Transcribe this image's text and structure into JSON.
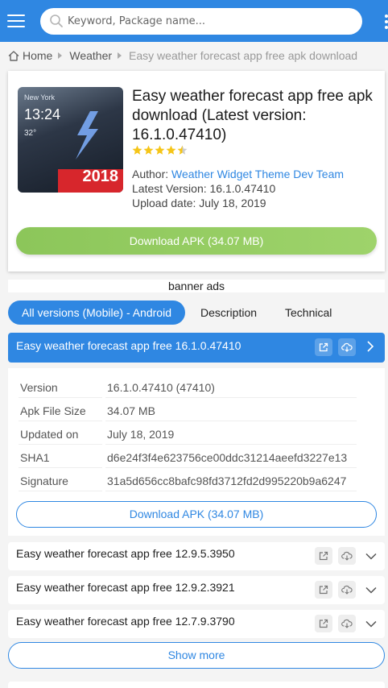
{
  "search": {
    "placeholder": "Keyword, Package name..."
  },
  "breadcrumb": {
    "home": "Home",
    "category": "Weather",
    "current": "Easy weather forecast app free apk download"
  },
  "app": {
    "icon_text": {
      "city": "New York",
      "time": "13:24",
      "temp": "32°",
      "year": "2018"
    },
    "title": "Easy weather forecast app free apk download (Latest version: 16.1.0.47410)",
    "rating": 4.5,
    "author_label": "Author:",
    "author": "Weather Widget Theme Dev Team",
    "latest_version": "Latest Version: 16.1.0.47410",
    "upload_date": "Upload date: July 18, 2019",
    "download_label": "Download APK (34.07 MB)"
  },
  "banner": "banner ads",
  "tabs": [
    "All versions (Mobile) - Android",
    "Description",
    "Technical"
  ],
  "current_version": {
    "title": "Easy weather forecast app free 16.1.0.47410",
    "details": [
      {
        "key": "Version",
        "value": "16.1.0.47410 (47410)"
      },
      {
        "key": "Apk File Size",
        "value": "34.07 MB"
      },
      {
        "key": "Updated on",
        "value": "July 18, 2019"
      },
      {
        "key": "SHA1",
        "value": "d6e24f3f4e623756ce00ddc31214aeefd3227e13"
      },
      {
        "key": "Signature",
        "value": "31a5d656cc8bafc98fd3712fd2d995220b9a6247"
      }
    ],
    "download_label": "Download APK (34.07 MB)"
  },
  "other_versions": [
    "Easy weather forecast app free 12.9.5.3950",
    "Easy weather forecast app free 12.9.2.3921",
    "Easy weather forecast app free 12.7.9.3790"
  ],
  "show_more": "Show more",
  "colors": {
    "accent": "#2f87e2",
    "download_green": "#8cc65a",
    "ribbon_red": "#d7262c",
    "star": "#f5c518"
  },
  "icons": [
    "menu-icon",
    "search-icon",
    "more-vertical-icon",
    "home-icon",
    "star-icon",
    "external-link-icon",
    "cloud-download-icon",
    "chevron-right-icon",
    "chevron-down-icon"
  ]
}
